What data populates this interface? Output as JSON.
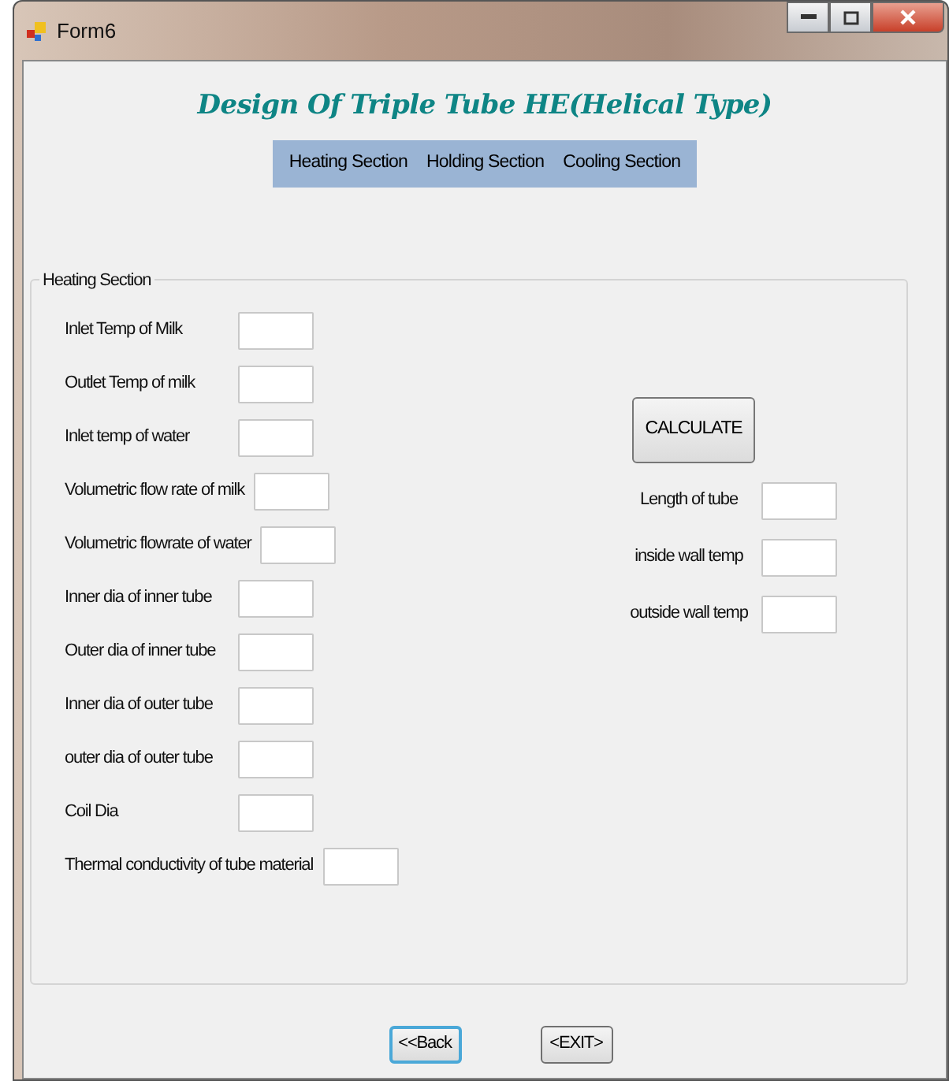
{
  "window": {
    "title": "Form6"
  },
  "heading": "Design Of Triple Tube HE(Helical Type)",
  "menu": [
    "Heating Section",
    "Holding Section",
    "Cooling Section"
  ],
  "group": {
    "title": "Heating Section",
    "inputs": [
      {
        "label": "Inlet Temp of Milk"
      },
      {
        "label": "Outlet Temp of milk"
      },
      {
        "label": "Inlet temp of water"
      },
      {
        "label": "Volumetric flow rate of milk"
      },
      {
        "label": "Volumetric flowrate of water"
      },
      {
        "label": "Inner dia of inner tube"
      },
      {
        "label": "Outer dia of inner tube"
      },
      {
        "label": "Inner dia of outer tube"
      },
      {
        "label": "outer dia of outer tube"
      },
      {
        "label": "Coil Dia"
      },
      {
        "label": "Thermal conductivity of tube material"
      }
    ],
    "calculate": "CALCULATE",
    "outputs": [
      {
        "label": "Length of tube"
      },
      {
        "label": "inside wall temp"
      },
      {
        "label": "outside wall temp"
      }
    ]
  },
  "buttons": [
    {
      "label": "<<Back",
      "focused": true
    },
    {
      "label": "<EXIT>",
      "focused": false
    }
  ]
}
